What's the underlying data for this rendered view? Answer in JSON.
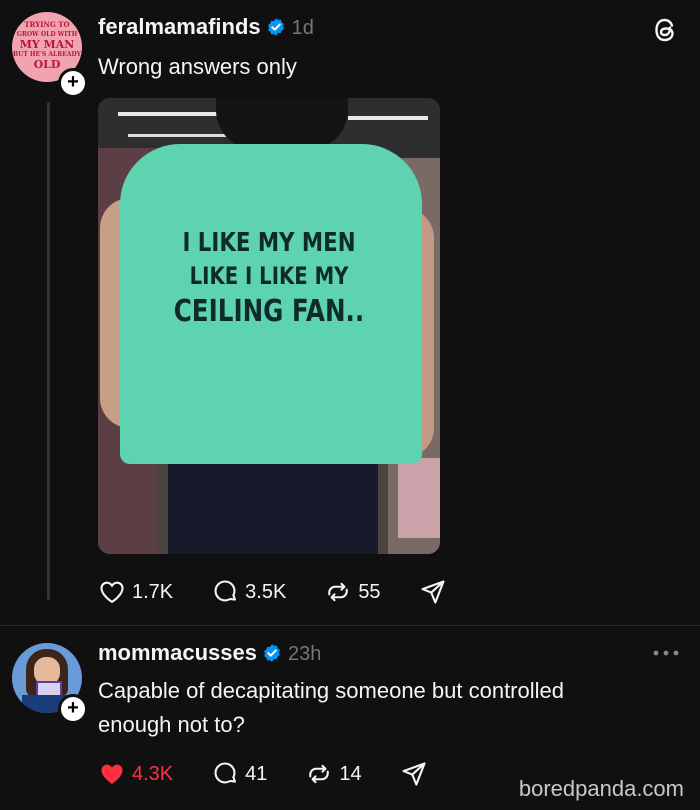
{
  "post1": {
    "username": "feralmamafinds",
    "time": "1d",
    "text": "Wrong answers only",
    "avatar_text": [
      "TRYING TO",
      "GROW OLD WITH",
      "MY MAN",
      "BUT HE'S ALREADY",
      "OLD"
    ],
    "shirt_lines": [
      "I LIKE MY MEN",
      "LIKE I LIKE MY",
      "CEILING FAN.."
    ],
    "likes": "1.7K",
    "replies": "3.5K",
    "reposts": "55"
  },
  "post2": {
    "username": "mommacusses",
    "time": "23h",
    "text_lines": [
      "Capable of decapitating someone but controlled",
      "enough not to?"
    ],
    "likes": "4.3K",
    "replies": "41",
    "reposts": "14",
    "liked": true
  },
  "watermark": "boredpanda.com",
  "colors": {
    "background": "#101010",
    "like_red": "#ff3040",
    "verified_blue": "#0095f6",
    "shirt": "#5ed3b0"
  },
  "icons": [
    "threads-logo-icon",
    "heart-icon",
    "comment-icon",
    "repost-icon",
    "share-icon",
    "more-icon",
    "verified-icon",
    "plus-icon"
  ]
}
